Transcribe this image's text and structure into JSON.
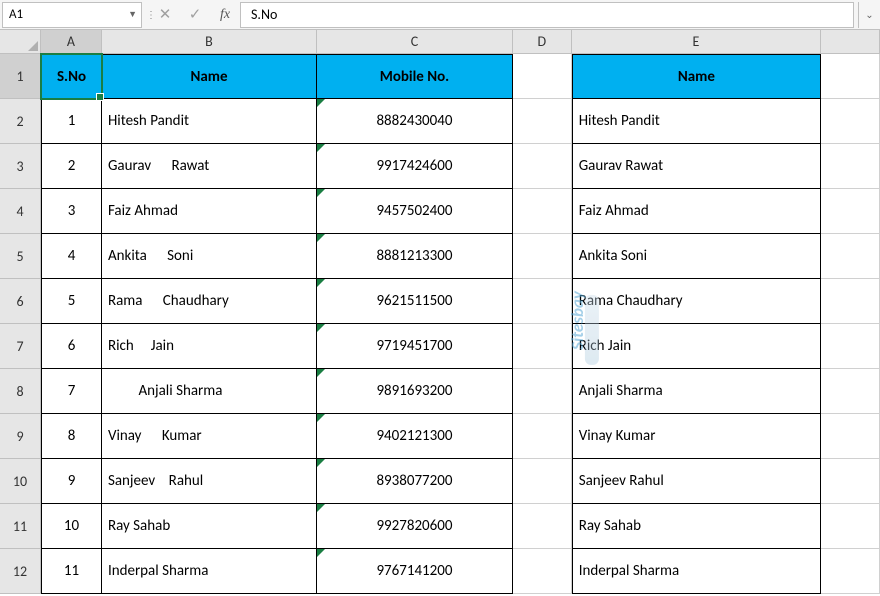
{
  "name_box": "A1",
  "formula_value": "S.No",
  "columns": [
    "A",
    "B",
    "C",
    "D",
    "E"
  ],
  "headers": {
    "sno": "S.No",
    "name": "Name",
    "mobile": "Mobile No.",
    "name2": "Name"
  },
  "rows": [
    {
      "sno": "1",
      "name": "Hitesh Pandit",
      "mobile": "8882430040",
      "name2": "Hitesh Pandit"
    },
    {
      "sno": "2",
      "name": "Gaurav      Rawat",
      "mobile": "9917424600",
      "name2": "Gaurav Rawat"
    },
    {
      "sno": "3",
      "name": "Faiz Ahmad",
      "mobile": "9457502400",
      "name2": "Faiz Ahmad"
    },
    {
      "sno": "4",
      "name": "Ankita      Soni",
      "mobile": "8881213300",
      "name2": "Ankita Soni"
    },
    {
      "sno": "5",
      "name": "Rama      Chaudhary",
      "mobile": "9621511500",
      "name2": "Rama Chaudhary"
    },
    {
      "sno": "6",
      "name": "Rich     Jain",
      "mobile": "9719451700",
      "name2": "Rich Jain"
    },
    {
      "sno": "7",
      "name": "         Anjali Sharma",
      "mobile": "9891693200",
      "name2": "Anjali Sharma"
    },
    {
      "sno": "8",
      "name": "Vinay      Kumar",
      "mobile": "9402121300",
      "name2": "Vinay Kumar"
    },
    {
      "sno": "9",
      "name": "Sanjeev    Rahul",
      "mobile": "8938077200",
      "name2": "Sanjeev Rahul"
    },
    {
      "sno": "10",
      "name": "Ray Sahab",
      "mobile": "9927820600",
      "name2": "Ray Sahab"
    },
    {
      "sno": "11",
      "name": "Inderpal Sharma",
      "mobile": "9767141200",
      "name2": "Inderpal Sharma"
    }
  ],
  "watermark": "Sitesbay"
}
